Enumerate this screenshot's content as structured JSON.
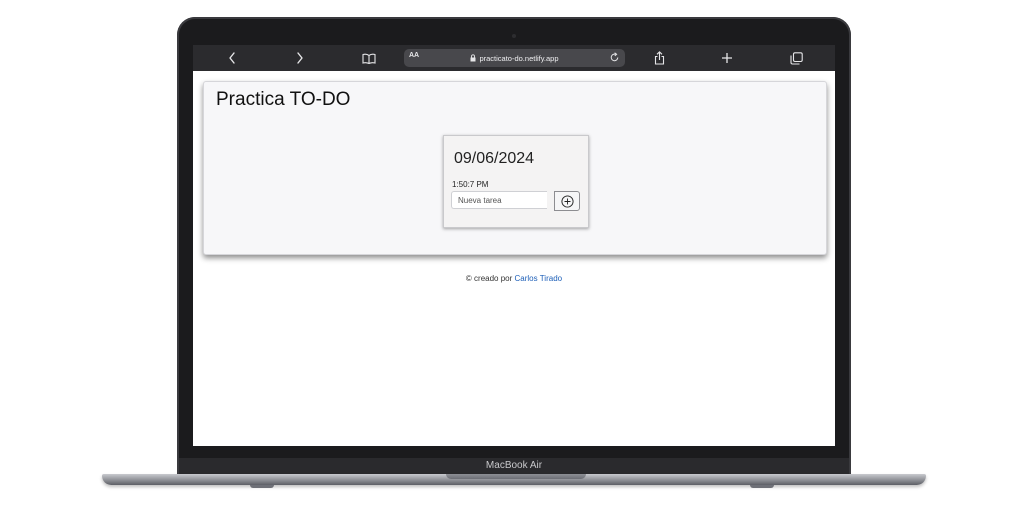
{
  "device": {
    "brand_label": "MacBook Air"
  },
  "browser": {
    "reader_label": "AA",
    "url": "practicato-do.netlify.app",
    "icons": [
      "back-icon",
      "forward-icon",
      "book-icon",
      "lock-icon",
      "reload-icon",
      "share-icon",
      "plus-icon",
      "tabs-icon"
    ]
  },
  "page": {
    "title": "Practica TO-DO",
    "widget": {
      "date": "09/06/2024",
      "time": "1:50:7 PM",
      "input_placeholder": "Nueva tarea",
      "input_value": "",
      "add_icon": "circle-plus-icon"
    },
    "footer": {
      "prefix": "© creado por",
      "author_link": "Carlos Tirado"
    }
  },
  "colors": {
    "link": "#1d5fb8",
    "toolbar": "#2b2b2e",
    "card": "#f7f7f9"
  }
}
